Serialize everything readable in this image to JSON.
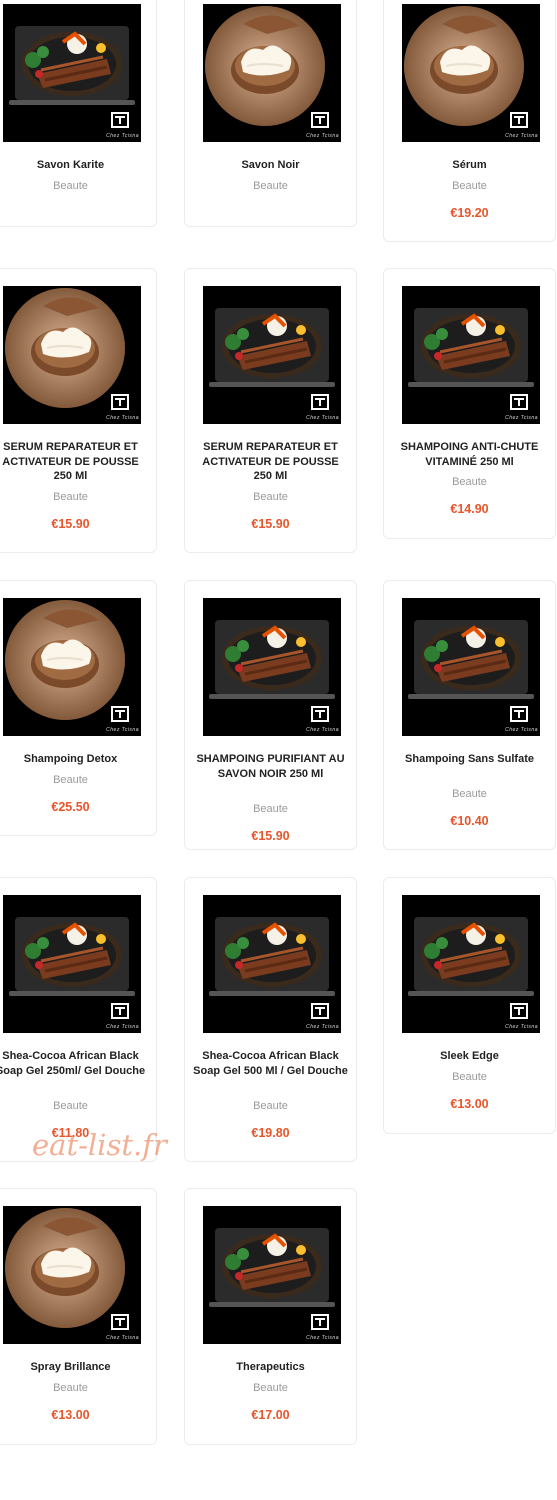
{
  "products": [
    {
      "name": "Savon Karite",
      "category": "Beaute",
      "price": "",
      "image": "food-plate-icon"
    },
    {
      "name": "Savon Noir",
      "category": "Beaute",
      "price": "",
      "image": "cream-bowl-icon"
    },
    {
      "name": "Sérum",
      "category": "Beaute",
      "price": "€19.20",
      "image": "cream-bowl-icon"
    },
    {
      "name": "SERUM REPARATEUR ET ACTIVATEUR DE POUSSE 250 Ml",
      "category": "Beaute",
      "price": "€15.90",
      "image": "cream-bowl-icon"
    },
    {
      "name": "SERUM REPARATEUR ET ACTIVATEUR DE POUSSE 250 Ml",
      "category": "Beaute",
      "price": "€15.90",
      "image": "food-plate-icon"
    },
    {
      "name": "SHAMPOING ANTI-CHUTE VITAMINÉ 250 Ml",
      "category": "Beaute",
      "price": "€14.90",
      "image": "food-plate-icon"
    },
    {
      "name": "Shampoing Detox",
      "category": "Beaute",
      "price": "€25.50",
      "image": "cream-bowl-icon"
    },
    {
      "name": "SHAMPOING PURIFIANT AU SAVON NOIR 250 Ml",
      "category": "Beaute",
      "price": "€15.90",
      "image": "food-plate-icon"
    },
    {
      "name": "Shampoing Sans Sulfate",
      "category": "Beaute",
      "price": "€10.40",
      "image": "food-plate-icon"
    },
    {
      "name": "Shea-Cocoa African Black Soap Gel 250ml/ Gel Douche",
      "category": "Beaute",
      "price": "€11.80",
      "image": "food-plate-icon"
    },
    {
      "name": "Shea-Cocoa African Black Soap Gel 500 Ml / Gel Douche",
      "category": "Beaute",
      "price": "€19.80",
      "image": "food-plate-icon"
    },
    {
      "name": "Sleek Edge",
      "category": "Beaute",
      "price": "€13.00",
      "image": "food-plate-icon"
    },
    {
      "name": "Spray Brillance",
      "category": "Beaute",
      "price": "€13.00",
      "image": "cream-bowl-icon"
    },
    {
      "name": "Therapeutics",
      "category": "Beaute",
      "price": "€17.00",
      "image": "food-plate-icon"
    }
  ],
  "logo_subtitle": "Chez Tcisna",
  "watermark": "eat-list.fr",
  "colors": {
    "price": "#e8552a",
    "category": "#9a9a9a",
    "title": "#222222",
    "card_border": "#ececec"
  }
}
